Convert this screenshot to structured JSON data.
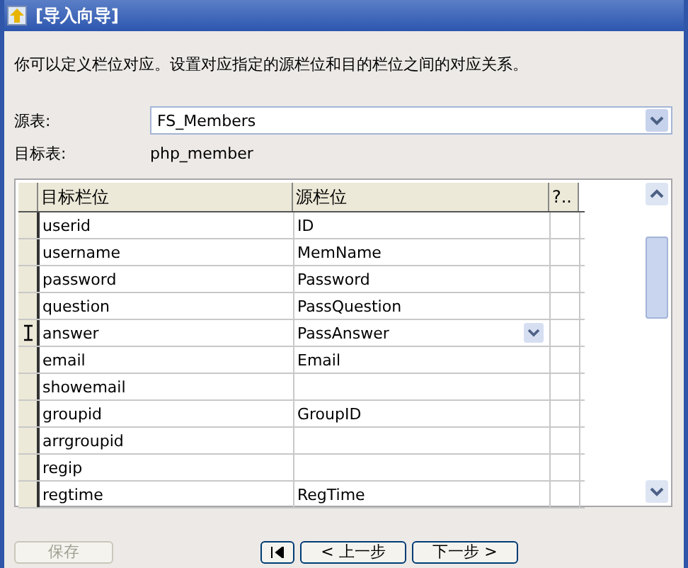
{
  "window": {
    "title": "[导入向导]"
  },
  "description": "你可以定义栏位对应。设置对应指定的源栏位和目的栏位之间的对应关系。",
  "source_table": {
    "label": "源表:",
    "value": "FS_Members"
  },
  "target_table": {
    "label": "目标表:",
    "value": "php_member"
  },
  "grid": {
    "columns": [
      "目标栏位",
      "源栏位",
      "?.."
    ],
    "rows": [
      {
        "target": "userid",
        "source": "ID",
        "selected": false
      },
      {
        "target": "username",
        "source": "MemName",
        "selected": false
      },
      {
        "target": "password",
        "source": "Password",
        "selected": false
      },
      {
        "target": "question",
        "source": "PassQuestion",
        "selected": false
      },
      {
        "target": "answer",
        "source": "PassAnswer",
        "selected": true
      },
      {
        "target": "email",
        "source": "Email",
        "selected": false
      },
      {
        "target": "showemail",
        "source": "",
        "selected": false
      },
      {
        "target": "groupid",
        "source": "GroupID",
        "selected": false
      },
      {
        "target": "arrgroupid",
        "source": "",
        "selected": false
      },
      {
        "target": "regip",
        "source": "",
        "selected": false
      },
      {
        "target": "regtime",
        "source": "RegTime",
        "selected": false
      }
    ]
  },
  "buttons": [
    {
      "kind": "save",
      "label": "保存",
      "disabled": true
    },
    {
      "kind": "first",
      "disabled": false
    },
    {
      "kind": "back",
      "label": "< 上一步",
      "disabled": false
    },
    {
      "kind": "next",
      "label": "下一步 >",
      "disabled": false
    }
  ]
}
